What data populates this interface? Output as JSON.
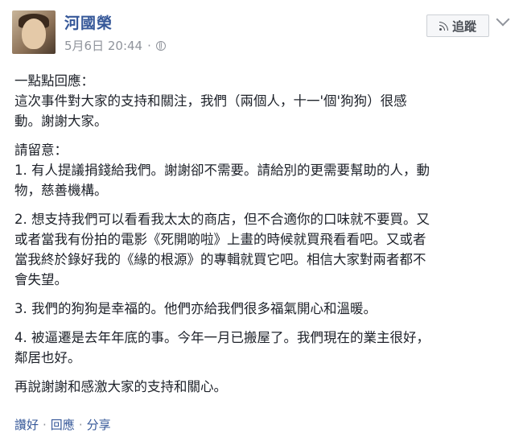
{
  "post": {
    "author": "河國榮",
    "date": "5月6日 20:44",
    "meta_separator": "·",
    "follow_label": "追蹤",
    "icons": {
      "follow": "rss-icon",
      "privacy": "globe-icon",
      "menu": "chevron-down-icon"
    },
    "lines": {
      "l1": "一點點回應：",
      "l2": "這次事件對大家的支持和關注，我們（兩個人，十一'個'狗狗）很感\n動。謝謝大家。",
      "l3": "請留意：",
      "l4": "1. 有人提議捐錢給我們。謝謝卻不需要。請給別的更需要幫助的人，動\n物，慈善機構。",
      "l5": "2. 想支持我們可以看看我太太的商店，但不合適你的口味就不要買。又\n或者當我有份拍的電影《死開啲啦》上畫的時候就買飛看看吧。又或者\n當我終於錄好我的《緣的根源》的專輯就買它吧。相信大家對兩者都不\n會失望。",
      "l6": "3. 我們的狗狗是幸福的。他們亦給我們很多福氣開心和溫暖。",
      "l7": "4. 被逼遷是去年年底的事。今年一月已搬屋了。我們現在的業主很好，\n鄰居也好。",
      "l8": "再說謝謝和感激大家的支持和關心。"
    },
    "actions": {
      "like": "讚好",
      "comment": "回應",
      "share": "分享",
      "separator": "·"
    }
  }
}
